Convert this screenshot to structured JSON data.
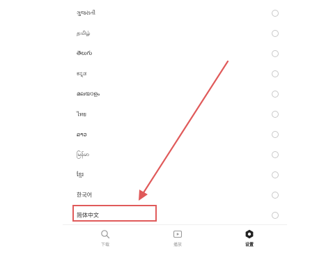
{
  "languages": [
    {
      "label": "ગુજરાતી",
      "selected": false
    },
    {
      "label": "தமிழ்",
      "selected": false
    },
    {
      "label": "తెలుగు",
      "selected": false
    },
    {
      "label": "ಕನ್ನಡ",
      "selected": false
    },
    {
      "label": "മലയാളം",
      "selected": false
    },
    {
      "label": "ไทย",
      "selected": false
    },
    {
      "label": "ລາວ",
      "selected": false
    },
    {
      "label": "မြန်မာ",
      "selected": false
    },
    {
      "label": "ខ្មែរ",
      "selected": false
    },
    {
      "label": "한국어",
      "selected": false
    },
    {
      "label": "简体中文",
      "selected": false
    }
  ],
  "bottom_nav": {
    "tabs": [
      {
        "label": "下载",
        "icon": "search-icon",
        "active": false
      },
      {
        "label": "播放",
        "icon": "play-icon",
        "active": false
      },
      {
        "label": "设置",
        "icon": "gear-icon",
        "active": true
      }
    ]
  },
  "colors": {
    "annotation": "#e05a5a",
    "radio_border": "#c8c8c8"
  }
}
